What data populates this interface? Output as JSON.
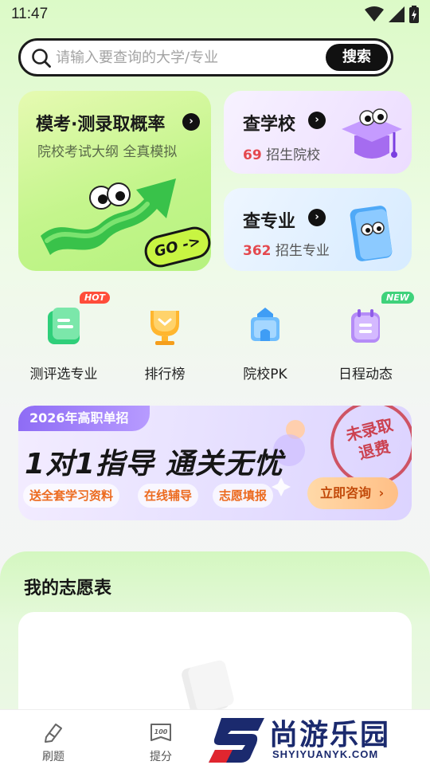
{
  "status_bar": {
    "time": "11:47"
  },
  "search": {
    "placeholder": "请输入要查询的大学/专业",
    "button": "搜索"
  },
  "cards": {
    "mock": {
      "title": "模考·测录取概率",
      "subtitle": "院校考试大纲  全真模拟",
      "badge": "GO ->"
    },
    "school": {
      "title": "查学校",
      "count": "69",
      "suffix": "招生院校"
    },
    "major": {
      "title": "查专业",
      "count": "362",
      "suffix": "招生专业"
    }
  },
  "quick_actions": [
    {
      "label": "测评选专业",
      "tag": "HOT",
      "icon": "scroll-icon"
    },
    {
      "label": "排行榜",
      "tag": "",
      "icon": "trophy-icon"
    },
    {
      "label": "院校PK",
      "tag": "",
      "icon": "school-building-icon"
    },
    {
      "label": "日程动态",
      "tag": "NEW",
      "icon": "calendar-icon"
    }
  ],
  "banner": {
    "tag": "2026年高职单招",
    "headline": "1对1指导  通关无忧",
    "chips": [
      "送全套学习资料",
      "在线辅导",
      "志愿填报"
    ],
    "cta": "立即咨询",
    "stamp_line1": "未录取",
    "stamp_line2": "退费"
  },
  "wishlist": {
    "title": "我的志愿表"
  },
  "tabs": [
    {
      "label": "刷题",
      "icon": "pencil-icon"
    },
    {
      "label": "提分",
      "icon": "score-100-icon"
    }
  ],
  "watermark": {
    "name": "尚游乐园",
    "url": "SHYIYUANYK.COM",
    "logo_letter": "S"
  },
  "colors": {
    "accent_green": "#b6f27f",
    "count_red": "#e4484e",
    "cta_orange": "#c24a0a",
    "banner_purple": "#8e6cf5"
  }
}
